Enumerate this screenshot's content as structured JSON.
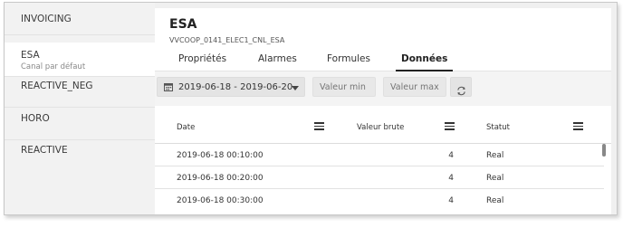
{
  "sidebar": {
    "items": [
      {
        "label": "INVOICING",
        "sub": ""
      },
      {
        "label": "ESA",
        "sub": "Canal par défaut"
      },
      {
        "label": "REACTIVE_NEG",
        "sub": ""
      },
      {
        "label": "HORO",
        "sub": ""
      },
      {
        "label": "REACTIVE",
        "sub": ""
      }
    ],
    "active_index": 1
  },
  "header": {
    "title": "ESA",
    "subtitle": "VVCOOP_0141_ELEC1_CNL_ESA"
  },
  "tabs": [
    {
      "label": "Propriétés"
    },
    {
      "label": "Alarmes"
    },
    {
      "label": "Formules"
    },
    {
      "label": "Données"
    }
  ],
  "active_tab": "Données",
  "toolbar": {
    "date_range": "2019-06-18 - 2019-06-20",
    "min_placeholder": "Valeur min",
    "max_placeholder": "Valeur max"
  },
  "table": {
    "columns": [
      "Date",
      "Valeur brute",
      "Statut"
    ],
    "rows": [
      {
        "date": "2019-06-18 00:10:00",
        "value": "4",
        "status": "Real"
      },
      {
        "date": "2019-06-18 00:20:00",
        "value": "4",
        "status": "Real"
      },
      {
        "date": "2019-06-18 00:30:00",
        "value": "4",
        "status": "Real"
      }
    ]
  },
  "icons": {
    "date": "calendar-icon",
    "dropdown": "caret-down-icon",
    "refresh": "refresh-icon",
    "column_menu": "menu-icon"
  },
  "colors": {
    "sidebar_bg": "#f2f2f2",
    "active_bg": "#ffffff",
    "toolbar_bg": "#f4f4f4"
  }
}
